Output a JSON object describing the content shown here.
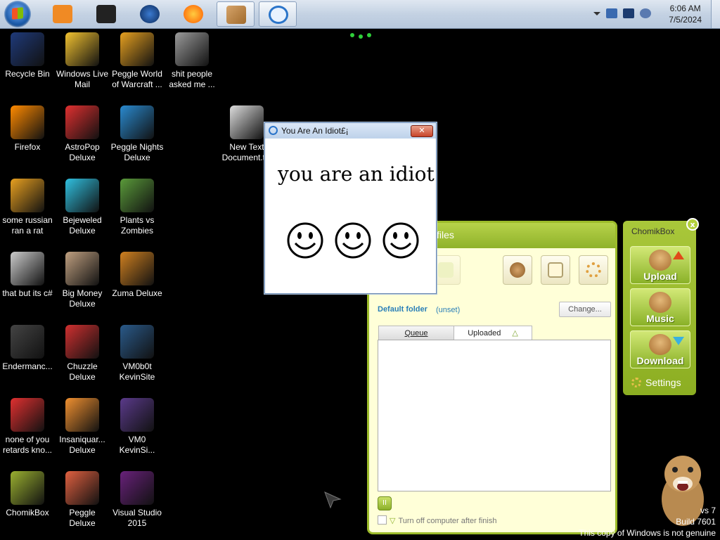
{
  "taskbar": {
    "items": [
      {
        "name": "media-player-icon",
        "color": "#f08a24"
      },
      {
        "name": "black-app-icon",
        "color": "#222222"
      },
      {
        "name": "globe-icon",
        "color": "#1c4d8c"
      },
      {
        "name": "firefox-icon",
        "color": "#ff7a00"
      },
      {
        "name": "chomikbox-taskbar-icon",
        "color": "#c08a4a"
      },
      {
        "name": "internet-explorer-icon",
        "color": "#2a74c9"
      }
    ],
    "clock_time": "6:06 AM",
    "clock_date": "7/5/2024"
  },
  "desktop_icons": [
    {
      "label": "Recycle Bin",
      "icon": "recycle-bin-icon",
      "color": "#1f3a7a"
    },
    {
      "label": "Windows Live Mail",
      "icon": "windows-live-mail-icon",
      "color": "#f2c230"
    },
    {
      "label": "Peggle World of Warcraft ...",
      "icon": "peggle-wow-icon",
      "color": "#e6a020"
    },
    {
      "label": "shit people asked me ...",
      "icon": "folder-icon",
      "color": "#9a9a9a"
    },
    {
      "label": "Firefox",
      "icon": "firefox-icon",
      "color": "#ff8a00"
    },
    {
      "label": "AstroPop Deluxe",
      "icon": "astropop-icon",
      "color": "#e03030"
    },
    {
      "label": "Peggle Nights Deluxe",
      "icon": "peggle-nights-icon",
      "color": "#2a8ad0"
    },
    {
      "label": "New Text Document.txt",
      "icon": "text-document-icon",
      "color": "#dddddd"
    },
    {
      "label": "some russian ran a rat",
      "icon": "rat-program-icon",
      "color": "#e8a020"
    },
    {
      "label": "Bejeweled Deluxe",
      "icon": "bejeweled-icon",
      "color": "#30c0e0"
    },
    {
      "label": "Plants vs Zombies",
      "icon": "plants-vs-zombies-icon",
      "color": "#5a9a3a"
    },
    {
      "label": "that but its c#",
      "icon": "shortcut-icon",
      "color": "#cccccc"
    },
    {
      "label": "Big Money Deluxe",
      "icon": "big-money-icon",
      "color": "#c0a080"
    },
    {
      "label": "Zuma Deluxe",
      "icon": "zuma-icon",
      "color": "#d08020"
    },
    {
      "label": "Endermanc...",
      "icon": "endermanch-icon",
      "color": "#444444"
    },
    {
      "label": "Chuzzle Deluxe",
      "icon": "chuzzle-icon",
      "color": "#d03030"
    },
    {
      "label": "VM0b0t KevinSite",
      "icon": "vm0b0t-icon",
      "color": "#2a5a8a"
    },
    {
      "label": "none of you retards kno...",
      "icon": "red-app-icon",
      "color": "#e03030"
    },
    {
      "label": "Insaniquar... Deluxe",
      "icon": "insaniquarium-icon",
      "color": "#f09030"
    },
    {
      "label": "VM0 KevinSi...",
      "icon": "vm0-icon",
      "color": "#5a3a8a"
    },
    {
      "label": "ChomikBox",
      "icon": "chomikbox-icon",
      "color": "#9ab030"
    },
    {
      "label": "Peggle Deluxe",
      "icon": "peggle-deluxe-icon",
      "color": "#e06040"
    },
    {
      "label": "Visual Studio 2015",
      "icon": "visual-studio-icon",
      "color": "#68217a"
    }
  ],
  "idiot_window": {
    "title": "You Are An Idiot£¡",
    "message": "you are an idiot",
    "close_label": "✕"
  },
  "chomik_main": {
    "header_fragment": "files",
    "default_folder_label": "Default folder",
    "default_folder_value": "(unset)",
    "change_button": "Change...",
    "tab_queue": "Queue",
    "tab_uploaded": "Uploaded",
    "shutdown_label": "Turn off computer after finish",
    "pause_symbol": "II"
  },
  "chomik_side": {
    "title": "ChomikBox",
    "close_label": "x",
    "upload_label": "Upload",
    "music_label": "Music",
    "download_label": "Download",
    "settings_label": "Settings"
  },
  "watermark": {
    "line1": "vs 7",
    "line2": "Build 7601",
    "line3": "This copy of Windows is not genuine"
  }
}
